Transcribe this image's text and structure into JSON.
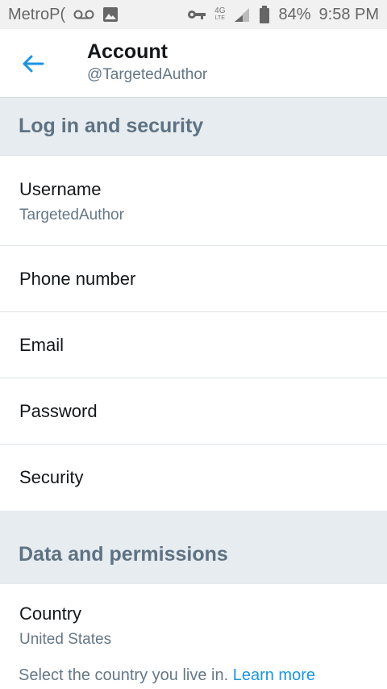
{
  "status_bar": {
    "carrier": "MetroP(",
    "network_top": "4G",
    "network_bottom": "LTE",
    "battery": "84%",
    "time": "9:58 PM"
  },
  "app_bar": {
    "title": "Account",
    "subtitle": "@TargetedAuthor",
    "accent_color": "#1b95e0"
  },
  "sections": {
    "login": {
      "header": "Log in and security",
      "items": [
        {
          "label": "Username",
          "value": "TargetedAuthor"
        },
        {
          "label": "Phone number"
        },
        {
          "label": "Email"
        },
        {
          "label": "Password"
        },
        {
          "label": "Security"
        }
      ]
    },
    "data": {
      "header": "Data and permissions",
      "country_label": "Country",
      "country_value": "United States",
      "hint_text": "Select the country you live in.",
      "learn_more": "Learn more"
    }
  }
}
